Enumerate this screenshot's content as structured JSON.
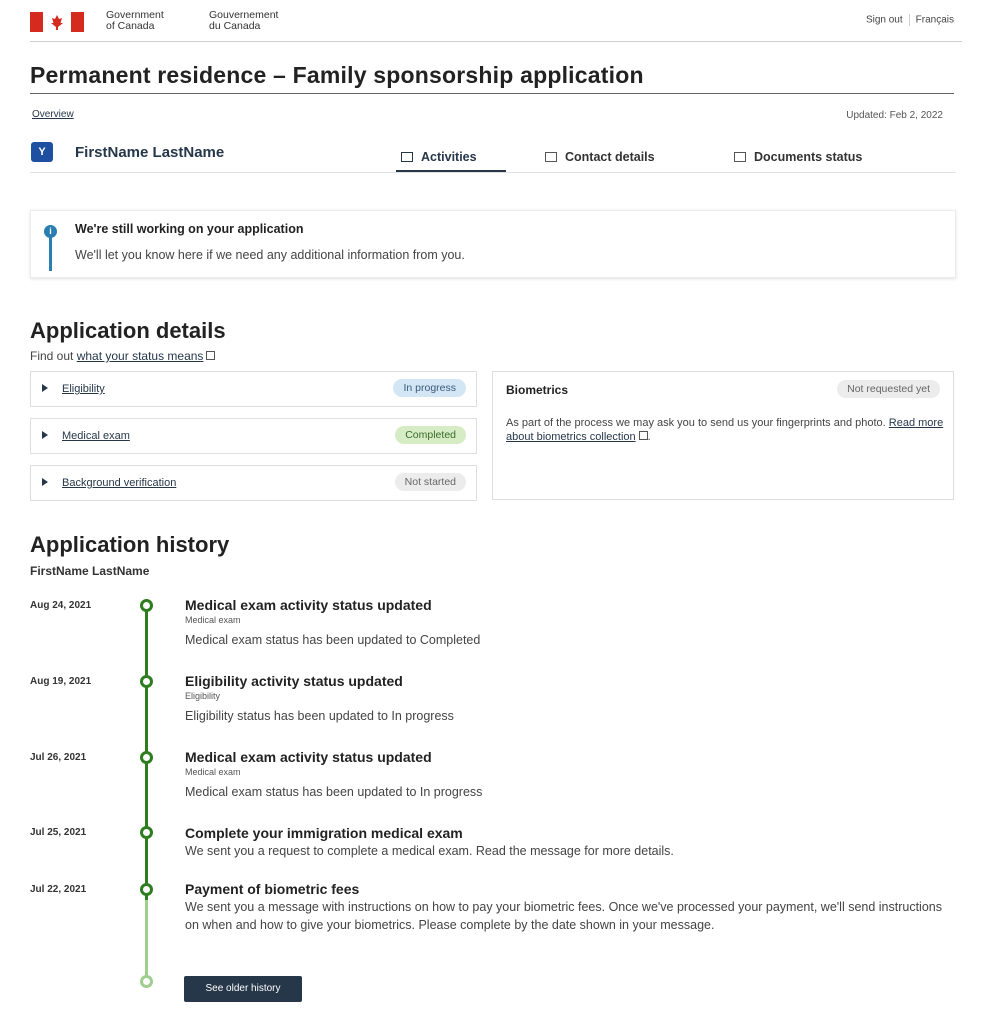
{
  "header": {
    "gov_en_line1": "Government",
    "gov_en_line2": "of Canada",
    "gov_fr_line1": "Gouvernement",
    "gov_fr_line2": "du Canada",
    "sign_out": "Sign out",
    "language": "Français",
    "flag_color": "#d52b1e"
  },
  "page": {
    "title": "Permanent residence – Family sponsorship application",
    "overview_link": "Overview",
    "updated": "Updated: Feb 2, 2022"
  },
  "user": {
    "avatar_initial": "Y",
    "name": "FirstName LastName"
  },
  "tabs": [
    {
      "label": "Activities",
      "icon": "activities-icon",
      "active": true
    },
    {
      "label": "Contact details",
      "icon": "contact-card-icon",
      "active": false
    },
    {
      "label": "Documents status",
      "icon": "documents-icon",
      "active": false
    }
  ],
  "info": {
    "title": "We're still working on your application",
    "text": "We'll let you know here if we need any additional information from you.",
    "accent_color": "#2a7fb0"
  },
  "details": {
    "heading": "Application details",
    "find_out_prefix": "Find out ",
    "find_out_link": "what your status means",
    "items": [
      {
        "label": "Eligibility",
        "status": "In progress"
      },
      {
        "label": "Medical exam",
        "status": "Completed"
      },
      {
        "label": "Background verification",
        "status": "Not started"
      }
    ],
    "biometrics": {
      "title": "Biometrics",
      "status": "Not requested yet",
      "text": "As part of the process we may ask you to send us your fingerprints and photo. ",
      "link": "Read more about biometrics collection",
      "suffix": "."
    }
  },
  "history": {
    "heading": "Application history",
    "name": "FirstName LastName",
    "entries": [
      {
        "date": "Aug 24, 2021",
        "title": "Medical exam activity status updated",
        "subtitle": "Medical exam",
        "description": "Medical exam status has been updated to Completed"
      },
      {
        "date": "Aug 19, 2021",
        "title": "Eligibility activity status updated",
        "subtitle": "Eligibility",
        "description": "Eligibility status has been updated to In progress"
      },
      {
        "date": "Jul 26, 2021",
        "title": "Medical exam activity status updated",
        "subtitle": "Medical exam",
        "description": "Medical exam status has been updated to In progress"
      },
      {
        "date": "Jul 25, 2021",
        "title": "Complete your immigration medical exam",
        "subtitle": "",
        "description": "We sent you a request to complete a medical exam. Read the message for more details."
      },
      {
        "date": "Jul 22, 2021",
        "title": "Payment of biometric fees",
        "subtitle": "",
        "description": "We sent you a message with instructions on how to pay your biometric fees. Once we've processed your payment, we'll send instructions on when and how to give your biometrics. Please complete by the date shown in your message."
      }
    ],
    "older_button": "See older history",
    "timeline_color": "#2e7d1e"
  }
}
